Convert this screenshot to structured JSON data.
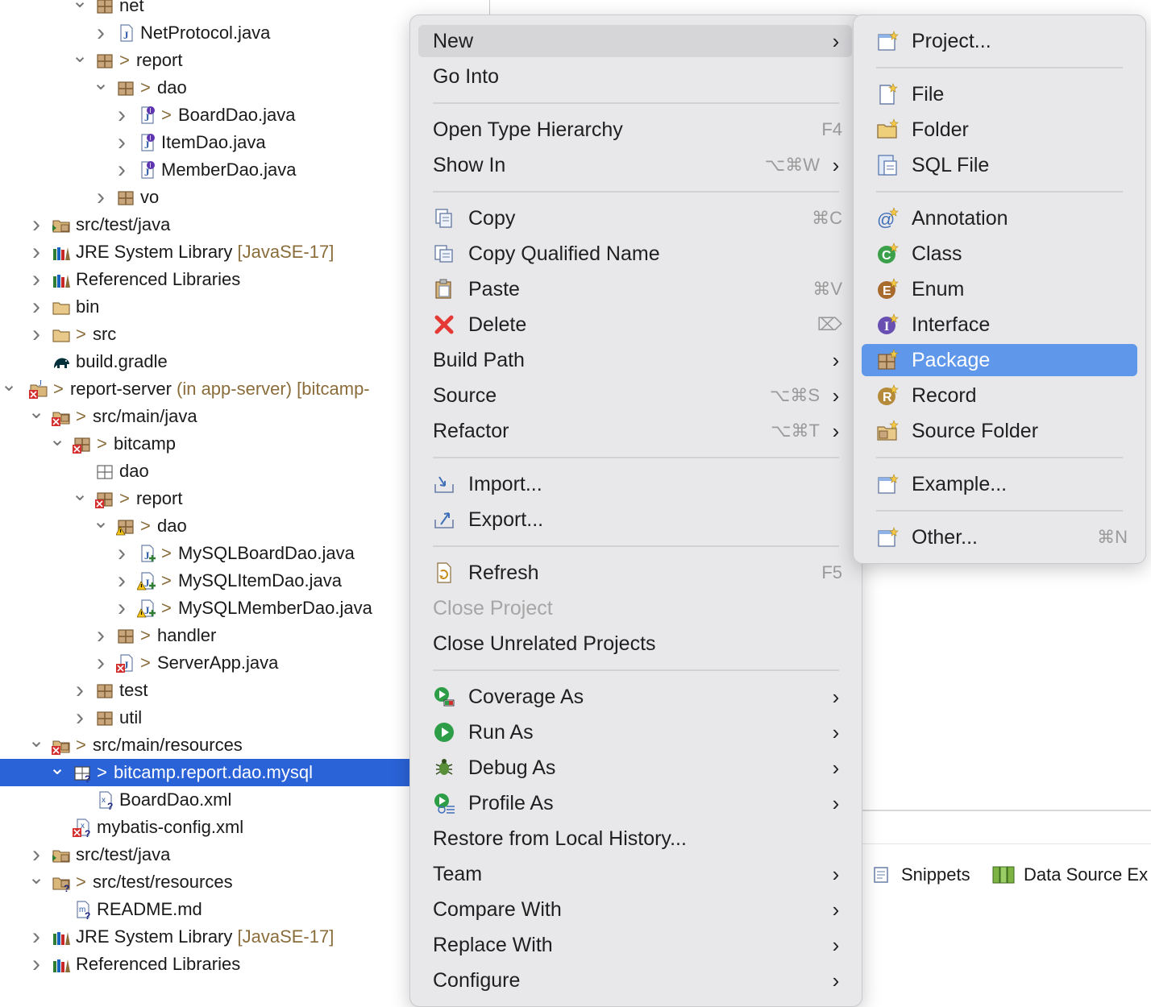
{
  "tree": {
    "rows": [
      {
        "label": "net",
        "icon": "package-icon"
      },
      {
        "label": "NetProtocol.java",
        "icon": "java-file-icon"
      },
      {
        "prefix": ">",
        "label": "report",
        "icon": "package-icon"
      },
      {
        "prefix": ">",
        "label": "dao",
        "icon": "package-icon"
      },
      {
        "prefix": ">",
        "label": "BoardDao.java",
        "icon": "java-interface-file-icon"
      },
      {
        "label": "ItemDao.java",
        "icon": "java-interface-file-icon"
      },
      {
        "label": "MemberDao.java",
        "icon": "java-interface-file-icon"
      },
      {
        "label": "vo",
        "icon": "package-icon"
      },
      {
        "label": "src/test/java",
        "icon": "source-folder-icon"
      },
      {
        "label": "JRE System Library",
        "suffix": "[JavaSE-17]",
        "icon": "library-icon"
      },
      {
        "label": "Referenced Libraries",
        "icon": "library-icon"
      },
      {
        "label": "bin",
        "icon": "folder-icon"
      },
      {
        "prefix": ">",
        "label": "src",
        "icon": "folder-icon"
      },
      {
        "label": "build.gradle",
        "icon": "gradle-elephant-icon"
      },
      {
        "prefix": ">",
        "label": "report-server",
        "suffix": "(in app-server) [bitcamp-",
        "icon": "project-error-icon"
      },
      {
        "prefix": ">",
        "label": "src/main/java",
        "icon": "source-folder-error-icon"
      },
      {
        "prefix": ">",
        "label": "bitcamp",
        "icon": "package-error-icon"
      },
      {
        "label": "dao",
        "icon": "empty-package-icon"
      },
      {
        "prefix": ">",
        "label": "report",
        "icon": "package-error-icon"
      },
      {
        "prefix": ">",
        "label": "dao",
        "icon": "package-warning-icon"
      },
      {
        "prefix": ">",
        "label": "MySQLBoardDao.java",
        "icon": "java-class-file-icon"
      },
      {
        "prefix": ">",
        "label": "MySQLItemDao.java",
        "icon": "java-class-warning-icon"
      },
      {
        "prefix": ">",
        "label": "MySQLMemberDao.java",
        "icon": "java-class-warning-icon"
      },
      {
        "prefix": ">",
        "label": "handler",
        "icon": "package-icon"
      },
      {
        "prefix": ">",
        "label": "ServerApp.java",
        "icon": "java-file-error-icon"
      },
      {
        "label": "test",
        "icon": "package-icon"
      },
      {
        "label": "util",
        "icon": "package-icon"
      },
      {
        "prefix": ">",
        "label": "src/main/resources",
        "icon": "source-folder-error-icon"
      },
      {
        "prefix": ">",
        "label": "bitcamp.report.dao.mysql",
        "icon": "package-unknown-icon"
      },
      {
        "label": "BoardDao.xml",
        "icon": "xml-file-icon"
      },
      {
        "label": "mybatis-config.xml",
        "icon": "xml-file-error-icon"
      },
      {
        "label": "src/test/java",
        "icon": "source-folder-icon"
      },
      {
        "prefix": ">",
        "label": "src/test/resources",
        "icon": "source-folder-unknown-icon"
      },
      {
        "label": "README.md",
        "icon": "md-file-icon"
      },
      {
        "label": "JRE System Library",
        "suffix": "[JavaSE-17]",
        "icon": "library-icon"
      },
      {
        "label": "Referenced Libraries",
        "icon": "library-icon"
      }
    ]
  },
  "context_menu": {
    "items": [
      {
        "label": "New",
        "submenu": true
      },
      {
        "label": "Go Into"
      },
      {
        "label": "Open Type Hierarchy",
        "shortcut": "F4"
      },
      {
        "label": "Show In",
        "shortcut": "⌥⌘W",
        "submenu": true
      },
      {
        "label": "Copy",
        "shortcut": "⌘C",
        "icon": "copy-icon"
      },
      {
        "label": "Copy Qualified Name",
        "icon": "copy-qualified-name-icon"
      },
      {
        "label": "Paste",
        "shortcut": "⌘V",
        "icon": "paste-icon"
      },
      {
        "label": "Delete",
        "shortcut": "⌦",
        "icon": "delete-icon"
      },
      {
        "label": "Build Path",
        "submenu": true
      },
      {
        "label": "Source",
        "shortcut": "⌥⌘S",
        "submenu": true
      },
      {
        "label": "Refactor",
        "shortcut": "⌥⌘T",
        "submenu": true
      },
      {
        "label": "Import...",
        "icon": "import-icon"
      },
      {
        "label": "Export...",
        "icon": "export-icon"
      },
      {
        "label": "Refresh",
        "shortcut": "F5",
        "icon": "refresh-icon"
      },
      {
        "label": "Close Project",
        "disabled": true
      },
      {
        "label": "Close Unrelated Projects"
      },
      {
        "label": "Coverage As",
        "icon": "coverage-icon",
        "submenu": true
      },
      {
        "label": "Run As",
        "icon": "run-icon",
        "submenu": true
      },
      {
        "label": "Debug As",
        "icon": "debug-bug-icon",
        "submenu": true
      },
      {
        "label": "Profile As",
        "icon": "profile-icon",
        "submenu": true
      },
      {
        "label": "Restore from Local History..."
      },
      {
        "label": "Team",
        "submenu": true
      },
      {
        "label": "Compare With",
        "submenu": true
      },
      {
        "label": "Replace With",
        "submenu": true
      },
      {
        "label": "Configure",
        "submenu": true
      }
    ]
  },
  "new_submenu": {
    "items": [
      {
        "label": "Project...",
        "icon": "new-project-icon"
      },
      {
        "label": "File",
        "icon": "new-file-icon"
      },
      {
        "label": "Folder",
        "icon": "new-folder-icon"
      },
      {
        "label": "SQL File",
        "icon": "sql-file-icon"
      },
      {
        "label": "Annotation",
        "icon": "annotation-icon"
      },
      {
        "label": "Class",
        "icon": "class-icon"
      },
      {
        "label": "Enum",
        "icon": "enum-icon"
      },
      {
        "label": "Interface",
        "icon": "interface-icon"
      },
      {
        "label": "Package",
        "icon": "new-package-icon",
        "highlighted": true
      },
      {
        "label": "Record",
        "icon": "record-icon"
      },
      {
        "label": "Source Folder",
        "icon": "new-source-folder-icon"
      },
      {
        "label": "Example...",
        "icon": "example-icon"
      },
      {
        "label": "Other...",
        "shortcut": "⌘N",
        "icon": "other-wizard-icon"
      }
    ]
  },
  "bottom_tabs": [
    {
      "label": "Snippets",
      "icon": "snippets-icon"
    },
    {
      "label": "Data Source Ex",
      "icon": "data-source-icon"
    }
  ],
  "colors": {
    "selection_blue": "#2a63d8",
    "menu_highlight": "#5f97ea",
    "menu_bg": "#e8e8ea",
    "decoration_text": "#8a6d3b"
  }
}
